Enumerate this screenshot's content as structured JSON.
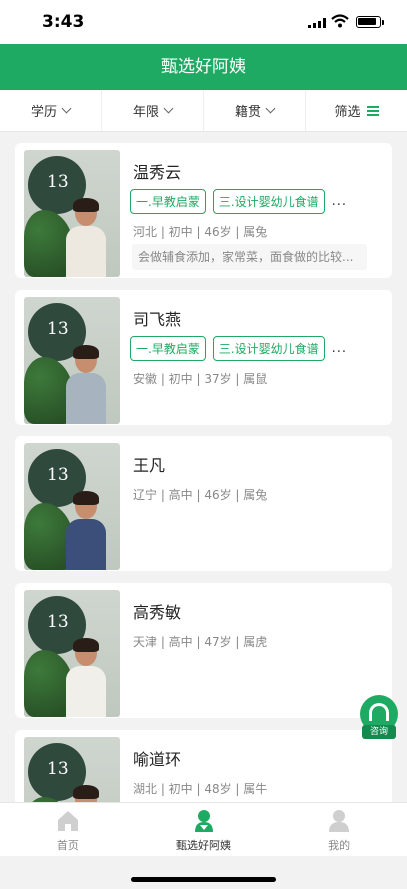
{
  "status_bar": {
    "time": "3:43"
  },
  "header": {
    "title": "甄选好阿姨"
  },
  "filters": [
    {
      "label": "学历"
    },
    {
      "label": "年限"
    },
    {
      "label": "籍贯"
    },
    {
      "label": "筛选"
    }
  ],
  "cards": [
    {
      "name": "温秀云",
      "tags": [
        "一.早教启蒙",
        "三.设计婴幼儿食谱"
      ],
      "more": "...",
      "info": "河北 | 初中 | 46岁 | 属兔",
      "desc": "会做辅食添加，家常菜，面食做的比较...",
      "photo_number": "13"
    },
    {
      "name": "司飞燕",
      "tags": [
        "一.早教启蒙",
        "三.设计婴幼儿食谱"
      ],
      "more": "...",
      "info": "安徽 | 初中 | 37岁 | 属鼠",
      "desc": "",
      "photo_number": "13"
    },
    {
      "name": "王凡",
      "tags": [],
      "more": "",
      "info": "辽宁 | 高中 | 46岁 | 属兔",
      "desc": "",
      "photo_number": "13"
    },
    {
      "name": "高秀敏",
      "tags": [],
      "more": "",
      "info": "天津 | 高中 | 47岁 | 属虎",
      "desc": "",
      "photo_number": "13"
    },
    {
      "name": "喻道环",
      "tags": [],
      "more": "",
      "info": "湖北 | 初中 | 48岁 | 属牛",
      "desc": "",
      "photo_number": "13"
    }
  ],
  "consult": {
    "label": "咨询"
  },
  "tabbar": [
    {
      "label": "首页",
      "icon": "home-icon"
    },
    {
      "label": "甄选好阿姨",
      "icon": "nanny-icon"
    },
    {
      "label": "我的",
      "icon": "profile-icon"
    }
  ],
  "colors": {
    "brand": "#1faa63",
    "background": "#f2f2f2"
  }
}
